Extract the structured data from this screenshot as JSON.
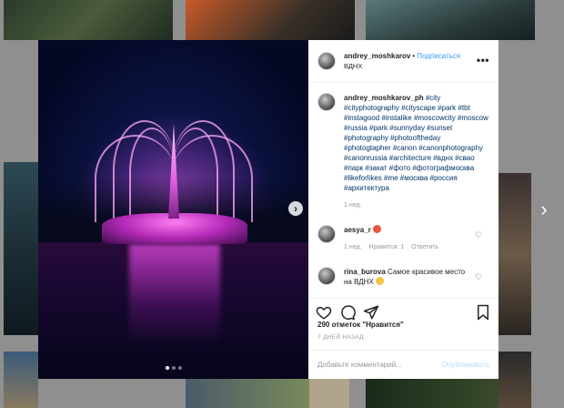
{
  "post": {
    "username": "andrey_moshkarov",
    "separator": "•",
    "follow_label": "Подписаться",
    "location": "ВДНХ",
    "more_label": "•••"
  },
  "caption": {
    "username": "andrey_moshkarov_ph",
    "tags": "#city #cityphotography #cityscape #park #tbt #instagood #instalike #moscowcity #moscow #russia #park #sunnyday #sunset #photography #photooftheday #photogtapher #canon #canonphotography #canonrussia #architecture #вднх #свао #парк #закат #фото #фотографмосква #likeforlikes #me #москва #россия #архитектура",
    "time": "1 нед."
  },
  "comments": [
    {
      "username": "aesya_r",
      "text": "",
      "emoji": "red",
      "time": "1 нед.",
      "likes": "Нравится: 1",
      "reply": "Ответить"
    },
    {
      "username": "rina_burova",
      "text": "Самое красивое место на ВДНХ",
      "emoji": "yellow"
    }
  ],
  "likes_text": "290 отметок \"Нравится\"",
  "date_text": "7 ДНЕЙ НАЗАД",
  "add_comment_placeholder": "Добавьте комментарий...",
  "publish_label": "Опубликовать",
  "nav": {
    "next_glyph": "›",
    "carousel_next_glyph": "›"
  },
  "carousel": {
    "count": 3,
    "active": 0
  },
  "colors": {
    "link": "#003569",
    "accent": "#3897f0",
    "muted": "#999999",
    "publish_disabled": "#b2dffc"
  }
}
